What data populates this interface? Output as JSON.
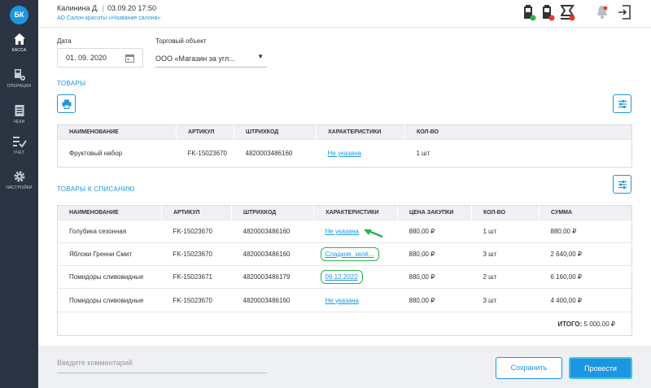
{
  "sidebar": {
    "logo": "БК",
    "items": [
      {
        "label": "КАССА",
        "icon": "home-icon"
      },
      {
        "label": "ОПЕРАЦИИ",
        "icon": "cash-register-icon"
      },
      {
        "label": "ЧЕКИ",
        "icon": "receipt-icon"
      },
      {
        "label": "УЧЁТ",
        "icon": "checklist-icon"
      },
      {
        "label": "НАСТРОЙКИ",
        "icon": "gear-icon"
      }
    ]
  },
  "header": {
    "user": "Калинина Д.",
    "datetime": "03.09.20 17:50",
    "company": "АО Салон красоты «Название салона»"
  },
  "filters": {
    "date_label": "Дата",
    "date_value": "01. 09. 2020",
    "object_label": "Торговый объект",
    "object_value": "ООО «Магазин за угл..."
  },
  "goods": {
    "title": "ТОВАРЫ",
    "columns": [
      "НАИМЕНОВАНИЕ",
      "АРТИКУЛ",
      "ШТРИХКОД",
      "ХАРАКТЕРИСТИКИ",
      "КОЛ-ВО"
    ],
    "rows": [
      {
        "name": "Фруктовый набор",
        "sku": "FK-15023670",
        "barcode": "4820003486160",
        "chars": "Не указана",
        "qty": "1 шт"
      }
    ]
  },
  "writeoff": {
    "title": "ТОВАРЫ К СПИСАНИЮ",
    "columns": [
      "НАИМЕНОВАНИЕ",
      "АРТИКУЛ",
      "ШТРИХКОД",
      "ХАРАКТЕРИСТИКИ",
      "ЦЕНА ЗАКУПКИ",
      "КОЛ-ВО",
      "СУММА"
    ],
    "rows": [
      {
        "name": "Голубика сезонная",
        "sku": "FK-15023670",
        "barcode": "4820003486160",
        "chars": "Не указана",
        "price": "880,00 ₽",
        "qty": "1 шт",
        "sum": "880,00 ₽"
      },
      {
        "name": "Яблоки Гренни Смит",
        "sku": "FK-15023670",
        "barcode": "4820003486160",
        "chars": "Сладкое, зелё...",
        "price": "880,00 ₽",
        "qty": "3 шт",
        "sum": "2 640,00 ₽"
      },
      {
        "name": "Помидоры сливовидные",
        "sku": "FK-15023671",
        "barcode": "4820003486179",
        "chars": "09.12.2022",
        "price": "880,00 ₽",
        "qty": "2 шт",
        "sum": "6 160,00 ₽"
      },
      {
        "name": "Помидоры сливовидные",
        "sku": "FK-15023670",
        "barcode": "4820003486160",
        "chars": "Не указана",
        "price": "880,00 ₽",
        "qty": "3 шт",
        "sum": "4 400,00 ₽"
      }
    ],
    "total_label": "ИТОГО:",
    "total_value": "5 000,00 ₽"
  },
  "footer": {
    "comment_placeholder": "Введите комментарий",
    "save_label": "Сохранить",
    "post_label": "Провести"
  },
  "colors": {
    "accent": "#1c96e0",
    "sidebar": "#2b3443",
    "highlight": "#2bb34a"
  }
}
